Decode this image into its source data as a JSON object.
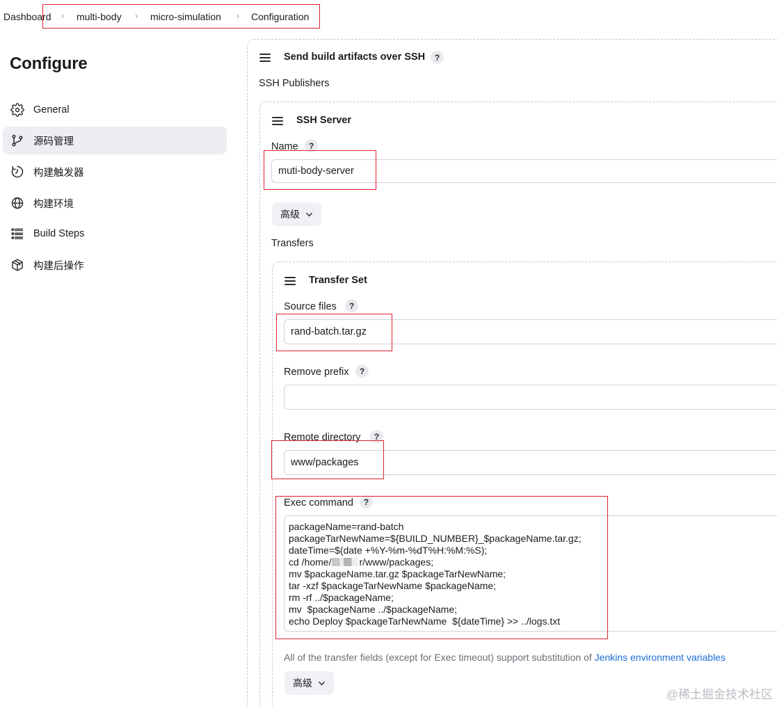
{
  "breadcrumb": {
    "items": [
      "Dashboard",
      "multi-body",
      "micro-simulation",
      "Configuration"
    ]
  },
  "sidebar": {
    "title": "Configure",
    "items": [
      {
        "label": "General",
        "icon": "gear-icon",
        "active": false
      },
      {
        "label": "源码管理",
        "icon": "branch-icon",
        "active": true
      },
      {
        "label": "构建触发器",
        "icon": "clock-icon",
        "active": false
      },
      {
        "label": "构建环境",
        "icon": "globe-icon",
        "active": false
      },
      {
        "label": "Build Steps",
        "icon": "list-icon",
        "active": false
      },
      {
        "label": "构建后操作",
        "icon": "package-icon",
        "active": false
      }
    ]
  },
  "main": {
    "section_title": "Send build artifacts over SSH",
    "publishers_label": "SSH Publishers",
    "server": {
      "title": "SSH Server",
      "name_label": "Name",
      "name_value": "muti-body-server",
      "advanced_label": "高级",
      "transfers_label": "Transfers"
    },
    "transfer_set": {
      "title": "Transfer Set",
      "source_files_label": "Source files",
      "source_files_value": "rand-batch.tar.gz",
      "remove_prefix_label": "Remove prefix",
      "remove_prefix_value": "",
      "remote_directory_label": "Remote directory",
      "remote_directory_value": "www/packages",
      "exec_command_label": "Exec command",
      "exec_command_lines": [
        "packageName=rand-batch",
        "packageTarNewName=${BUILD_NUMBER}_$packageName.tar.gz;",
        "dateTime=$(date +%Y-%m-%dT%H:%M:%S);",
        "r/www/packages;",
        "mv $packageName.tar.gz $packageTarNewName;",
        "tar -xzf $packageTarNewName $packageName;",
        "rm -rf ../$packageName;",
        "mv  $packageName ../$packageName;",
        "echo Deploy $packageTarNewName  ${dateTime} >> ../logs.txt"
      ],
      "exec_cd_prefix": "cd /home/",
      "note_text": "All of the transfer fields (except for Exec timeout) support substitution of ",
      "note_link": "Jenkins environment variables",
      "advanced_label": "高级"
    },
    "help_symbol": "?"
  },
  "watermark": "@稀土掘金技术社区",
  "colors": {
    "highlight_box": "#e0232e",
    "link": "#1a6fd6",
    "active_sidebar_bg": "#eceef2"
  }
}
